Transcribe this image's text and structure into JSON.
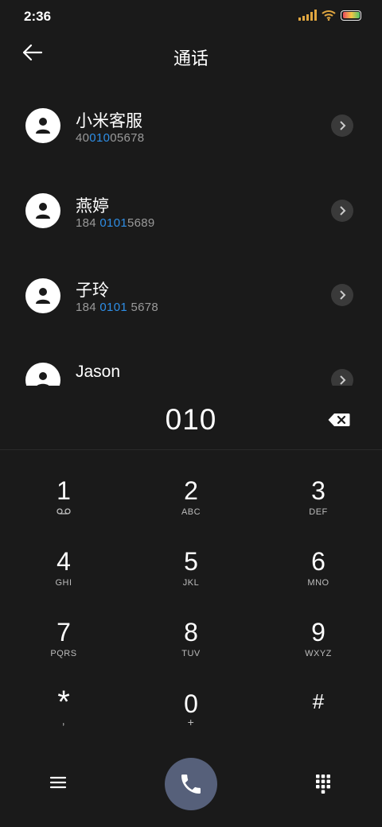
{
  "status_bar": {
    "time": "2:36"
  },
  "header": {
    "title": "通话"
  },
  "contacts": [
    {
      "name": "小米客服",
      "number_pre": "40",
      "number_match": "010",
      "number_post": "05678"
    },
    {
      "name": "燕婷",
      "number_pre": "184 ",
      "number_match": "0101",
      "number_post": "5689"
    },
    {
      "name": "子玲",
      "number_pre": "184 ",
      "number_match": "0101",
      "number_post": " 5678"
    },
    {
      "name": "Jason",
      "number_pre": "",
      "number_match": "",
      "number_post": ""
    }
  ],
  "dialer": {
    "number": "010"
  },
  "keypad": [
    {
      "digit": "1",
      "letters": ""
    },
    {
      "digit": "2",
      "letters": "ABC"
    },
    {
      "digit": "3",
      "letters": "DEF"
    },
    {
      "digit": "4",
      "letters": "GHI"
    },
    {
      "digit": "5",
      "letters": "JKL"
    },
    {
      "digit": "6",
      "letters": "MNO"
    },
    {
      "digit": "7",
      "letters": "PQRS"
    },
    {
      "digit": "8",
      "letters": "TUV"
    },
    {
      "digit": "9",
      "letters": "WXYZ"
    },
    {
      "digit": "*",
      "letters": ","
    },
    {
      "digit": "0",
      "letters": "+"
    },
    {
      "digit": "#",
      "letters": ""
    }
  ],
  "colors": {
    "background": "#1a1a1a",
    "highlight": "#2e8ee6",
    "call_button": "#56607a"
  },
  "icons": [
    "signal-icon",
    "wifi-icon",
    "battery-icon",
    "back-arrow-icon",
    "avatar-icon",
    "chevron-right-icon",
    "backspace-icon",
    "voicemail-icon",
    "menu-icon",
    "phone-icon",
    "dialpad-icon"
  ]
}
